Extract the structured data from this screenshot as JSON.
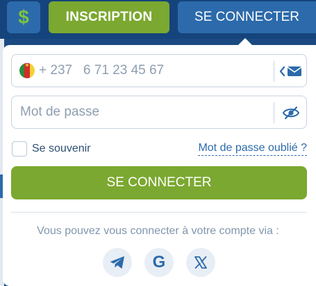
{
  "topbar": {
    "currency_icon": "dollar-icon",
    "currency_glyph": "$",
    "register_label": "INSCRIPTION",
    "login_label": "SE CONNECTER"
  },
  "login_form": {
    "phone": {
      "country_flag": "cameroon-flag-icon",
      "value": "+ 237   6 71 23 45 67",
      "switch_icon": "chevron-left-icon",
      "switch_target_icon": "envelope-icon"
    },
    "password": {
      "placeholder": "Mot de passe",
      "visibility_icon": "eye-slash-icon"
    },
    "remember_label": "Se souvenir",
    "remember_checked": false,
    "forgot_label": "Mot de passe oublié ?",
    "submit_label": "SE CONNECTER",
    "social_prompt": "Vous pouvez vous connecter à votre compte via :",
    "social_providers": [
      {
        "name": "Telegram",
        "icon": "telegram-icon"
      },
      {
        "name": "Google",
        "icon": "google-icon"
      },
      {
        "name": "X",
        "icon": "x-icon"
      }
    ]
  },
  "colors": {
    "header_bg": "#15447c",
    "primary_blue": "#2c6aab",
    "accent_green": "#7ba830",
    "text_muted": "#8e9eb0"
  }
}
